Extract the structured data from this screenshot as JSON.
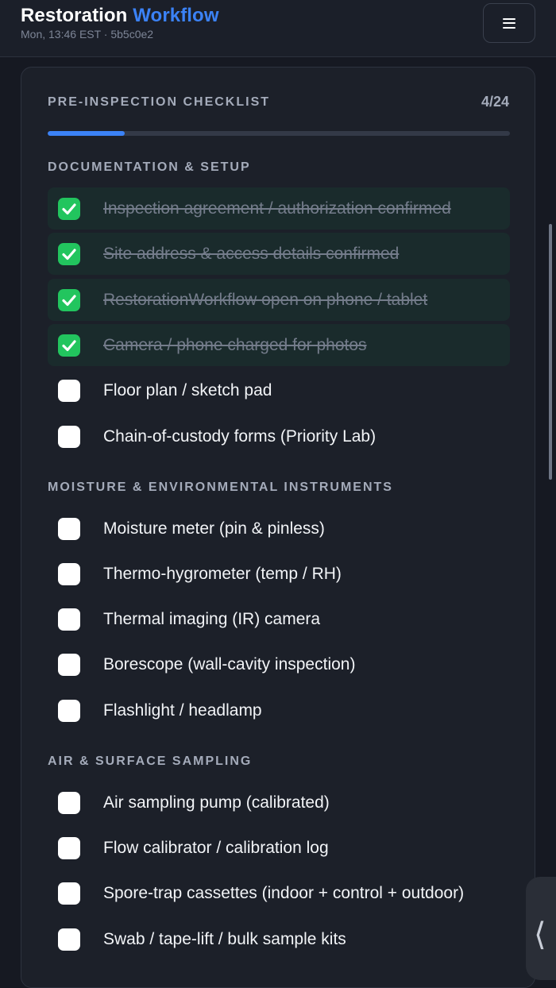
{
  "header": {
    "title_main": "Restoration",
    "title_accent": "Workflow",
    "subtitle": "Mon, 13:46 EST · 5b5c0e2",
    "menu_icon": "hamburger-menu-icon"
  },
  "checklist": {
    "title": "PRE-INSPECTION CHECKLIST",
    "count": "4/24",
    "progress_fraction": 0.1667,
    "sections": [
      {
        "title": "DOCUMENTATION & SETUP",
        "items": [
          {
            "label": "Inspection agreement / authorization confirmed",
            "checked": true
          },
          {
            "label": "Site address & access details confirmed",
            "checked": true
          },
          {
            "label": "RestorationWorkflow open on phone / tablet",
            "checked": true
          },
          {
            "label": "Camera / phone charged for photos",
            "checked": true
          },
          {
            "label": "Floor plan / sketch pad",
            "checked": false
          },
          {
            "label": "Chain-of-custody forms (Priority Lab)",
            "checked": false
          }
        ]
      },
      {
        "title": "MOISTURE & ENVIRONMENTAL INSTRUMENTS",
        "items": [
          {
            "label": "Moisture meter (pin & pinless)",
            "checked": false
          },
          {
            "label": "Thermo-hygrometer (temp / RH)",
            "checked": false
          },
          {
            "label": "Thermal imaging (IR) camera",
            "checked": false
          },
          {
            "label": "Borescope (wall-cavity inspection)",
            "checked": false
          },
          {
            "label": "Flashlight / headlamp",
            "checked": false
          }
        ]
      },
      {
        "title": "AIR & SURFACE SAMPLING",
        "items": [
          {
            "label": "Air sampling pump (calibrated)",
            "checked": false
          },
          {
            "label": "Flow calibrator / calibration log",
            "checked": false
          },
          {
            "label": "Spore-trap cassettes (indoor + control + outdoor)",
            "checked": false
          },
          {
            "label": "Swab / tape-lift / bulk sample kits",
            "checked": false
          }
        ]
      }
    ]
  },
  "side_handle": {
    "icon": "chevron-left-icon",
    "glyph": "⟨"
  },
  "colors": {
    "accent": "#3b82f6",
    "checked": "#22c55e",
    "background": "#161922",
    "card": "#1c2029"
  }
}
